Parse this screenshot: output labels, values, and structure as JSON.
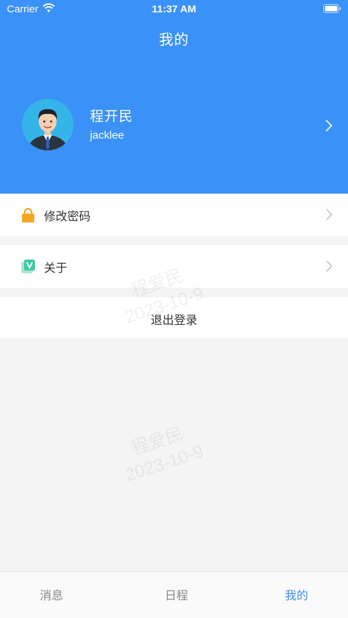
{
  "status_bar": {
    "carrier": "Carrier",
    "time": "11:37 AM"
  },
  "header": {
    "title": "我的"
  },
  "profile": {
    "name": "程开民",
    "account": "jacklee"
  },
  "menu": [
    {
      "label": "修改密码",
      "icon": "lock-icon"
    },
    {
      "label": "关于",
      "icon": "about-icon"
    }
  ],
  "logout_label": "退出登录",
  "watermark": {
    "name": "程爱民",
    "date": "2023-10-9"
  },
  "tabs": [
    {
      "label": "消息",
      "active": false
    },
    {
      "label": "日程",
      "active": false
    },
    {
      "label": "我的",
      "active": true
    }
  ],
  "colors": {
    "accent": "#3a91f8",
    "lock": "#f5a623",
    "about": "#3fc9a5"
  }
}
